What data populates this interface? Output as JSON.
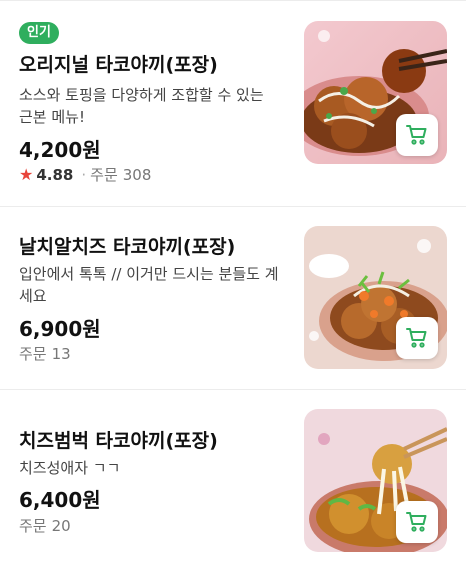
{
  "menu_items": [
    {
      "badge": "인기",
      "name": "오리지널 타코야끼(포장)",
      "description": "소스와 토핑을 다양하게 조합할 수 있는 근본 메뉴!",
      "price": "4,200원",
      "rating": "4.88",
      "orders_label": "주문",
      "orders_count": "308"
    },
    {
      "name": "날치알치즈 타코야끼(포장)",
      "description": "입안에서 톡톡 // 이거만 드시는 분들도 계세요",
      "price": "6,900원",
      "orders_label": "주문",
      "orders_count": "13"
    },
    {
      "name": "치즈범벅 타코야끼(포장)",
      "description": "치즈성애자 ㄱㄱ",
      "price": "6,400원",
      "orders_label": "주문",
      "orders_count": "20"
    }
  ],
  "colors": {
    "accent_green": "#2fae5e",
    "star_red": "#e8443a"
  },
  "icons": [
    "star-icon",
    "cart-icon"
  ]
}
